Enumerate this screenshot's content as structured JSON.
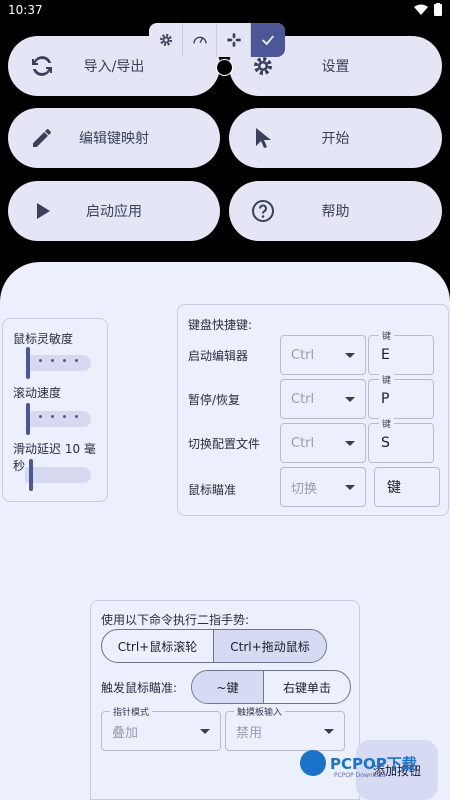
{
  "statusbar": {
    "time": "10:37"
  },
  "top_buttons": {
    "import_export": "导入/导出",
    "settings": "设置",
    "edit_keymap": "编辑键映射",
    "start": "开始",
    "launch_app": "启动应用",
    "help": "帮助"
  },
  "mouse_card": {
    "sensitivity_label": "鼠标灵敏度",
    "scroll_label": "滚动速度",
    "delay_label": "滑动延迟 10 毫秒"
  },
  "keyboard_card": {
    "title": "键盘快捷键:",
    "key_field_label": "键",
    "rows": [
      {
        "label": "启动编辑器",
        "modifier": "Ctrl",
        "key": "E"
      },
      {
        "label": "暂停/恢复",
        "modifier": "Ctrl",
        "key": "P"
      },
      {
        "label": "切换配置文件",
        "modifier": "Ctrl",
        "key": "S"
      },
      {
        "label": "鼠标瞄准",
        "modifier": "切换",
        "key": "键"
      }
    ]
  },
  "gesture_card": {
    "title": "使用以下命令执行二指手势:",
    "option1": "Ctrl+鼠标滚轮",
    "option2": "Ctrl+拖动鼠标",
    "aim_label": "触发鼠标瞄准:",
    "aim_option1": "~键",
    "aim_option2": "右键单击",
    "pointer_mode_label": "指针模式",
    "pointer_mode_value": "叠加",
    "touchpad_label": "触摸板输入",
    "touchpad_value": "禁用"
  },
  "fab": {
    "label": "添加按钮"
  },
  "watermark": {
    "brand": "PCPOP下载",
    "sub": "PCPOP Download"
  },
  "colors": {
    "accent": "#4b5797",
    "surface": "#eceffc",
    "button": "#e4e6f6"
  }
}
